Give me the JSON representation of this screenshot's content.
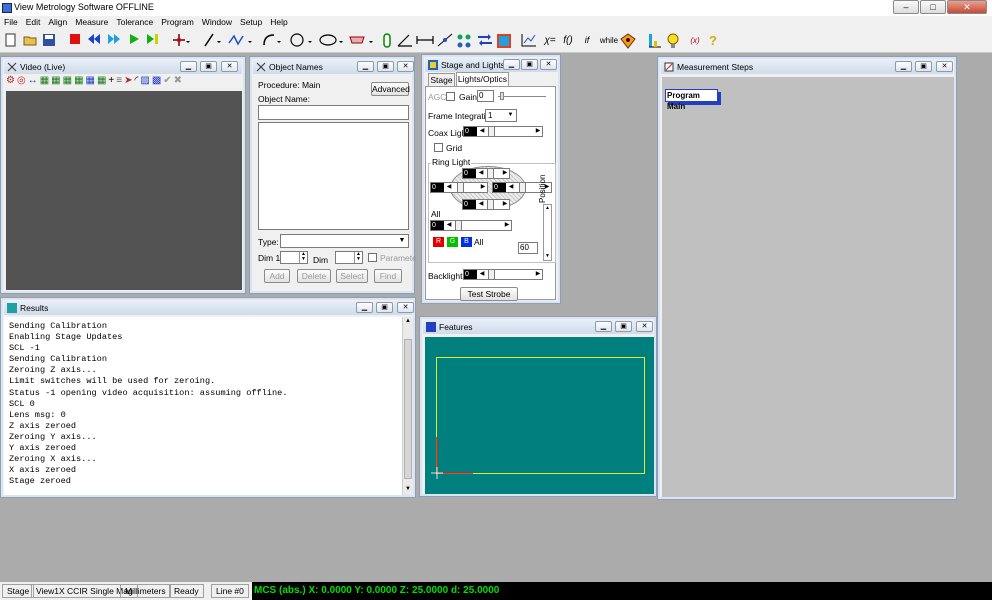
{
  "app": {
    "title": "View Metrology Software OFFLINE"
  },
  "window_controls": {
    "minimize": "–",
    "maximize": "□",
    "close": "✕"
  },
  "menu": [
    "File",
    "Edit",
    "Align",
    "Measure",
    "Tolerance",
    "Program",
    "Window",
    "Setup",
    "Help"
  ],
  "toolbar_icons": [
    "new-file-icon",
    "open-folder-icon",
    "save-icon",
    "stop-icon",
    "rewind-icon",
    "fast-forward-icon",
    "play-icon",
    "step-icon",
    "point-icon",
    "line-icon",
    "polyline-icon",
    "arc-icon",
    "circle-icon",
    "ellipse-icon",
    "slot-icon",
    "cylinder-icon",
    "angle-icon",
    "distance-icon",
    "pattern-icon",
    "transfer-icon",
    "report-icon",
    "graph-icon",
    "chi-squared-icon",
    "function-icon",
    "if-icon",
    "while-icon",
    "calculator-icon",
    "probe-icon",
    "lightbulb-icon",
    "formula-icon",
    "help-icon"
  ],
  "toolbar_text": {
    "chi": "χ=",
    "func": "f()",
    "if": "if",
    "while": "while",
    "fx": "(x)",
    "question": "?"
  },
  "video": {
    "title": "Video (Live)"
  },
  "object_names": {
    "title": "Object Names",
    "procedure_label": "Procedure: Main",
    "object_name_label": "Object Name:",
    "advanced_button": "Advanced",
    "type_label": "Type:",
    "dim1_label": "Dim 1",
    "dim_label": "Dim",
    "parameter_label": "Paramete",
    "add_button": "Add",
    "delete_button": "Delete",
    "select_button": "Select",
    "find_button": "Find"
  },
  "stage_lights": {
    "title": "Stage and Lights",
    "tab_stage": "Stage",
    "tab_lights": "Lights/Optics",
    "agc_label": "AGC",
    "gain_label": "Gain",
    "gain_value": "0",
    "frame_label": "Frame Integratio",
    "frame_value": "1",
    "coax_label": "Coax Light",
    "coax_value": "0",
    "grid_label": "Grid",
    "ring_label": "Ring Light",
    "ring_values": [
      "0",
      "0",
      "0",
      "0"
    ],
    "all_label": "All",
    "all_value": "0",
    "r_label": "R",
    "g_label": "G",
    "b_label": "B",
    "rgb_all_label": "All",
    "position_label": "Position",
    "position_value": "60",
    "backlight_label": "Backlight",
    "backlight_value": "0",
    "test_strobe_button": "Test Strobe"
  },
  "results": {
    "title": "Results",
    "lines": [
      "Sending Calibration",
      "Enabling Stage Updates",
      "SCL -1",
      "Sending Calibration",
      "Zeroing Z axis...",
      "Limit switches will be used for zeroing.",
      "Status -1 opening video acquisition: assuming offline.",
      "SCL 0",
      "Lens msg: 0",
      "Z axis zeroed",
      "Zeroing Y axis...",
      "Y axis zeroed",
      "Zeroing X axis...",
      "X axis zeroed",
      "Stage zeroed"
    ]
  },
  "features": {
    "title": "Features",
    "bg_color": "#007f7f",
    "border_color": "#e8e830"
  },
  "measurement_steps": {
    "title": "Measurement Steps",
    "program_main": "Program Main"
  },
  "status": {
    "stage": "Stage",
    "view": "View1X CCIR Single Mag",
    "units": "Millimeters",
    "ready": "Ready",
    "line": "Line #0",
    "coords": "MCS (abs.)  X: 0.0000  Y: 0.0000  Z: 25.0000  d: 25.0000"
  }
}
